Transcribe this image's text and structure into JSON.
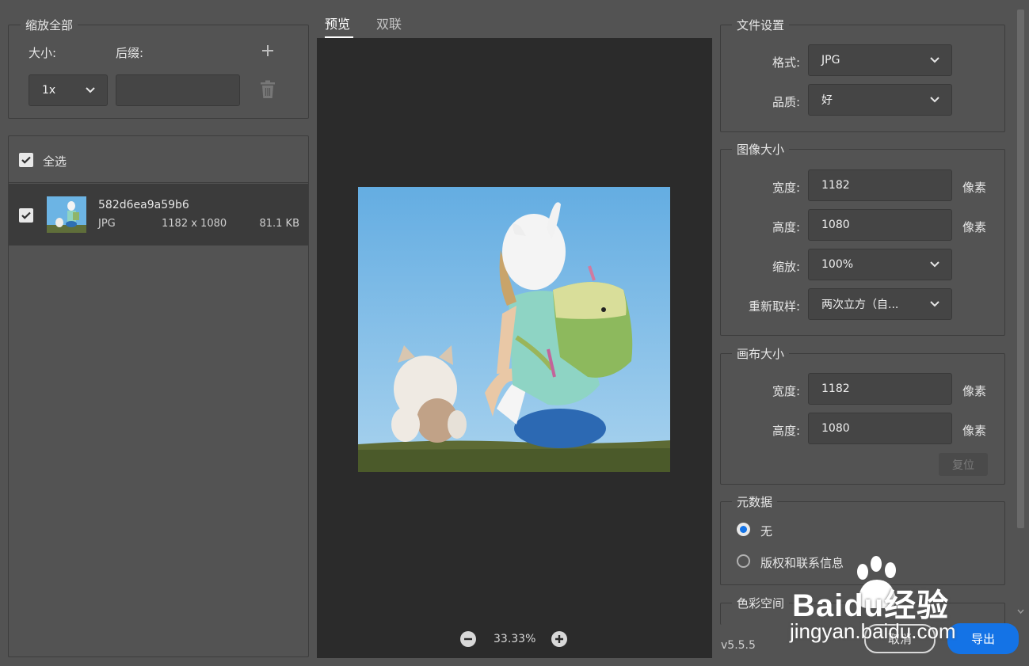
{
  "scale_all": {
    "legend": "缩放全部",
    "size_label": "大小:",
    "suffix_label": "后缀:",
    "size_value": "1x",
    "suffix_value": "",
    "add_icon": "plus-icon",
    "delete_icon": "trash-icon"
  },
  "file_list": {
    "select_all_label": "全选",
    "items": [
      {
        "name": "582d6ea9a59b6",
        "format": "JPG",
        "dimensions": "1182 x 1080",
        "size": "81.1 KB",
        "checked": true
      }
    ]
  },
  "tabs": [
    {
      "label": "预览",
      "active": true
    },
    {
      "label": "双联",
      "active": false
    }
  ],
  "preview": {
    "zoom": "33.33%"
  },
  "file_settings": {
    "legend": "文件设置",
    "format_label": "格式:",
    "format_value": "JPG",
    "quality_label": "品质:",
    "quality_value": "好"
  },
  "image_size": {
    "legend": "图像大小",
    "width_label": "宽度:",
    "width_value": "1182",
    "height_label": "高度:",
    "height_value": "1080",
    "scale_label": "缩放:",
    "scale_value": "100%",
    "resample_label": "重新取样:",
    "resample_value": "两次立方（自...",
    "unit": "像素"
  },
  "canvas_size": {
    "legend": "画布大小",
    "width_label": "宽度:",
    "width_value": "1182",
    "height_label": "高度:",
    "height_value": "1080",
    "unit": "像素",
    "reset_label": "复位"
  },
  "metadata": {
    "legend": "元数据",
    "options": [
      {
        "label": "无",
        "selected": true
      },
      {
        "label": "版权和联系信息",
        "selected": false
      }
    ]
  },
  "color_space": {
    "legend": "色彩空间"
  },
  "footer": {
    "version": "v5.5.5",
    "cancel_label": "取消",
    "export_label": "导出"
  },
  "watermark": {
    "brand": "Baidu经验",
    "url": "jingyan.baidu.com"
  },
  "colors": {
    "accent": "#1473e6",
    "background": "#535353",
    "preview_bg": "#2b2b2b",
    "sky": "#6cb4e4"
  }
}
